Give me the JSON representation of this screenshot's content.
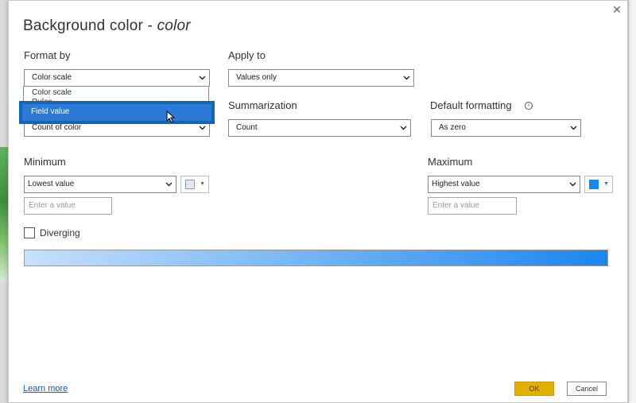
{
  "dialog": {
    "title_main": "Background color - ",
    "title_field": "color",
    "close_glyph": "✕"
  },
  "format_by": {
    "label": "Format by",
    "value": "Color scale",
    "options": [
      "Color scale",
      "Rules",
      "Field value"
    ],
    "selected_option": "Field value"
  },
  "apply_to": {
    "label": "Apply to",
    "value": "Values only"
  },
  "based_on_field": {
    "value": "Count of color"
  },
  "summarization": {
    "label": "Summarization",
    "value": "Count"
  },
  "default_formatting": {
    "label": "Default formatting",
    "info_glyph": "i",
    "value": "As zero"
  },
  "minimum": {
    "label": "Minimum",
    "value": "Lowest value",
    "input_placeholder": "Enter a value",
    "color": "#dde9f7"
  },
  "maximum": {
    "label": "Maximum",
    "value": "Highest value",
    "input_placeholder": "Enter a value",
    "color": "#1a86f0"
  },
  "diverging": {
    "label": "Diverging",
    "checked": false
  },
  "gradient": {
    "from": "#c8e0fb",
    "to": "#1a86f0"
  },
  "footer": {
    "learn_more": "Learn more",
    "ok_label": "OK",
    "cancel_label": "Cancel"
  }
}
